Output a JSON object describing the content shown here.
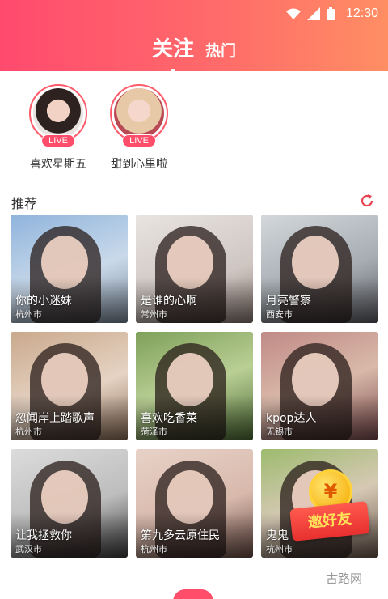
{
  "status_bar": {
    "time": "12:30",
    "icons": [
      "wifi-icon",
      "signal-icon",
      "battery-icon"
    ]
  },
  "header": {
    "tabs": [
      {
        "label": "关注",
        "active": true
      },
      {
        "label": "热门",
        "active": false
      }
    ],
    "colors": {
      "gradient_start": "#ff4a6e",
      "gradient_end": "#ff8e63"
    }
  },
  "live": {
    "badge": "LIVE",
    "items": [
      {
        "name": "喜欢星期五"
      },
      {
        "name": "甜到心里啦"
      }
    ]
  },
  "recommend": {
    "title": "推荐",
    "refresh_icon": "refresh-icon",
    "cards": [
      {
        "name": "你的小迷妹",
        "city": "杭州市"
      },
      {
        "name": "是谁的心啊",
        "city": "常州市"
      },
      {
        "name": "月亮警察",
        "city": "西安市"
      },
      {
        "name": "忽闻岸上踏歌声",
        "city": "杭州市"
      },
      {
        "name": "喜欢吃香菜",
        "city": "菏泽市"
      },
      {
        "name": "kpop达人",
        "city": "无锡市"
      },
      {
        "name": "让我拯救你",
        "city": "武汉市"
      },
      {
        "name": "第九多云原住民",
        "city": "杭州市"
      },
      {
        "name": "鬼鬼",
        "city": "杭州市"
      }
    ]
  },
  "invite": {
    "coin_symbol": "¥",
    "label": "邀好友"
  },
  "watermark": "古路网"
}
